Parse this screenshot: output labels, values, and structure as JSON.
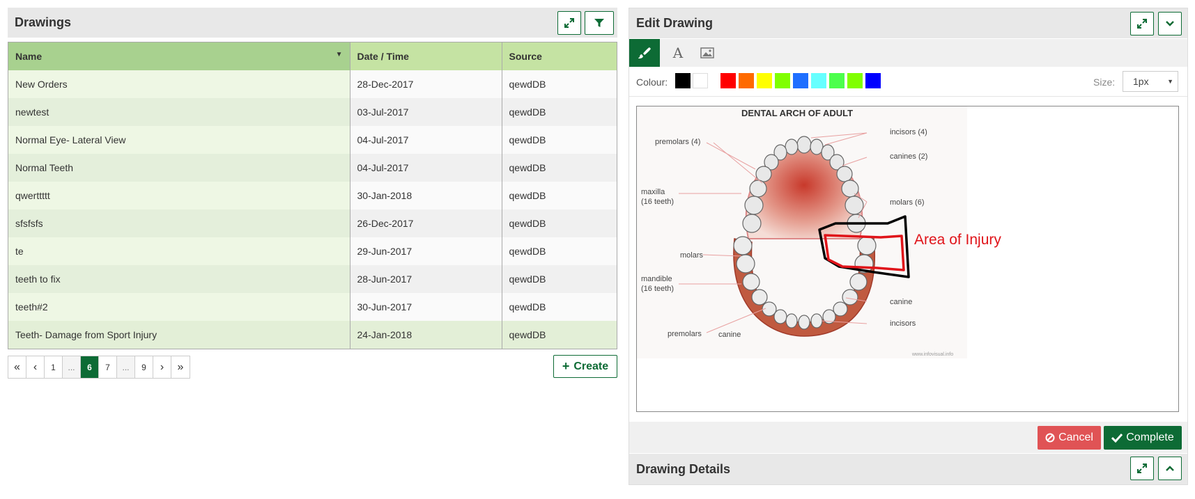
{
  "left": {
    "title": "Drawings",
    "columns": [
      "Name",
      "Date / Time",
      "Source"
    ],
    "rows": [
      {
        "name": "New Orders",
        "date": "28-Dec-2017",
        "source": "qewdDB"
      },
      {
        "name": "newtest",
        "date": "03-Jul-2017",
        "source": "qewdDB"
      },
      {
        "name": "Normal Eye- Lateral View",
        "date": "04-Jul-2017",
        "source": "qewdDB"
      },
      {
        "name": "Normal Teeth",
        "date": "04-Jul-2017",
        "source": "qewdDB"
      },
      {
        "name": "qwerttttt",
        "date": "30-Jan-2018",
        "source": "qewdDB"
      },
      {
        "name": "sfsfsfs",
        "date": "26-Dec-2017",
        "source": "qewdDB"
      },
      {
        "name": "te",
        "date": "29-Jun-2017",
        "source": "qewdDB"
      },
      {
        "name": "teeth to fix",
        "date": "28-Jun-2017",
        "source": "qewdDB"
      },
      {
        "name": "teeth#2",
        "date": "30-Jun-2017",
        "source": "qewdDB"
      },
      {
        "name": "Teeth- Damage from Sport Injury",
        "date": "24-Jan-2018",
        "source": "qewdDB"
      }
    ],
    "pager": {
      "first": "«",
      "prev": "‹",
      "p1": "1",
      "dots1": "...",
      "current": "6",
      "p7": "7",
      "dots2": "...",
      "p9": "9",
      "next": "›",
      "last": "»"
    },
    "create_label": "Create"
  },
  "right": {
    "title": "Edit Drawing",
    "colour_label": "Colour:",
    "colours": [
      "#000000",
      "#ffffff",
      "#ff0000",
      "#ff6a00",
      "#ffff00",
      "#80ff00",
      "#1f6fff",
      "#66ffff",
      "#4cff4c",
      "#80ff00",
      "#0000ff"
    ],
    "size_label": "Size:",
    "size_value": "1px",
    "image": {
      "heading": "DENTAL ARCH OF ADULT",
      "labels": {
        "premolars_top": "premolars (4)",
        "incisors_top": "incisors (4)",
        "canines_top": "canines (2)",
        "maxilla": "maxilla",
        "maxilla_count": "(16 teeth)",
        "molars_right": "molars (6)",
        "molars_left": "molars",
        "mandible": "mandible",
        "mandible_count": "(16 teeth)",
        "canine_right": "canine",
        "incisors_bottom": "incisors",
        "premolars_bottom": "premolars",
        "canine_bottom": "canine",
        "credit": "www.infovisual.info"
      },
      "annotation": "Area of Injury"
    },
    "cancel_label": "Cancel",
    "complete_label": "Complete",
    "details_title": "Drawing Details",
    "accent": "#0d6b35",
    "cancel_color": "#e05355"
  }
}
